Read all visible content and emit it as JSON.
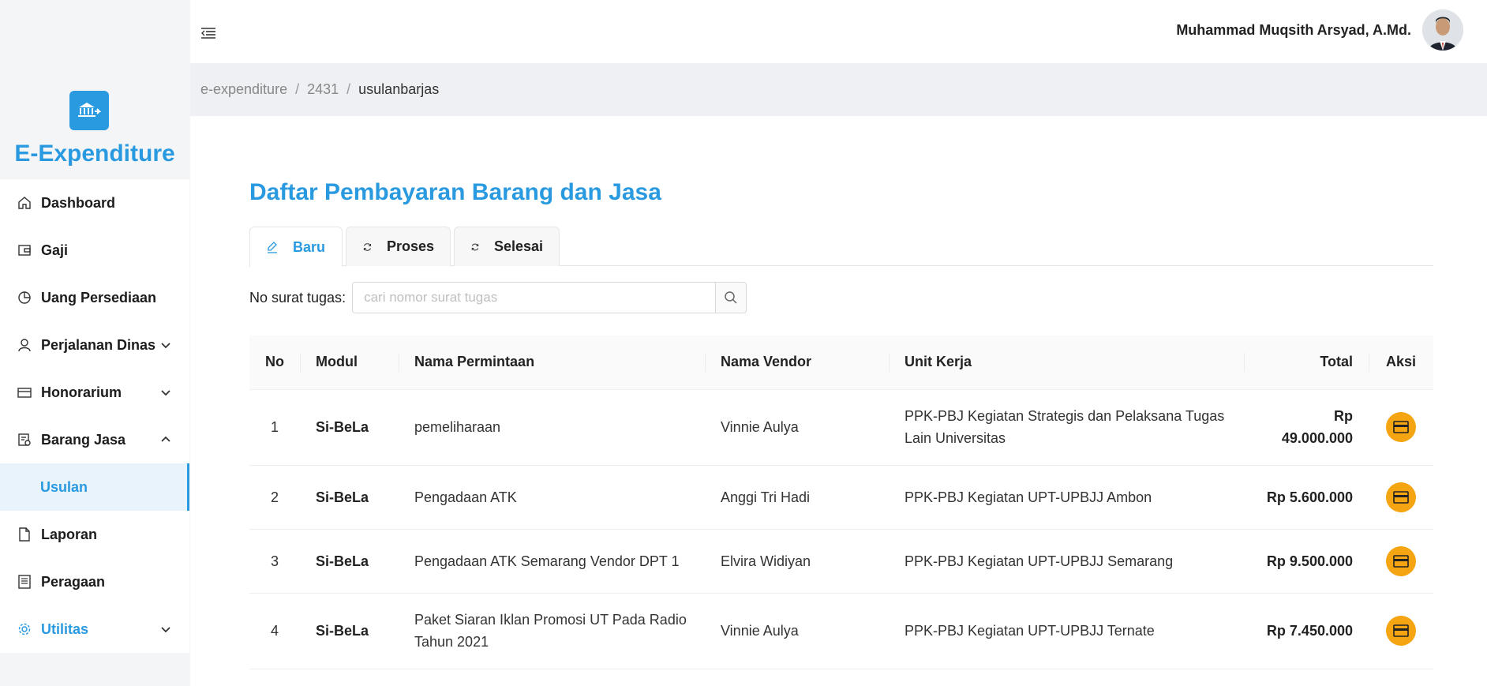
{
  "brand": {
    "name": "E-Expenditure"
  },
  "sidebar": {
    "items": [
      {
        "label": "Dashboard"
      },
      {
        "label": "Gaji"
      },
      {
        "label": "Uang Persediaan"
      },
      {
        "label": "Perjalanan Dinas"
      },
      {
        "label": "Honorarium"
      },
      {
        "label": "Barang Jasa"
      },
      {
        "label": "Usulan"
      },
      {
        "label": "Laporan"
      },
      {
        "label": "Peragaan"
      },
      {
        "label": "Utilitas"
      }
    ]
  },
  "header": {
    "username": "Muhammad Muqsith Arsyad, A.Md."
  },
  "breadcrumb": {
    "items": [
      "e-expenditure",
      "2431",
      "usulanbarjas"
    ]
  },
  "page": {
    "title": "Daftar Pembayaran Barang dan Jasa"
  },
  "tabs": [
    {
      "label": "Baru",
      "icon": "edit-icon"
    },
    {
      "label": "Proses",
      "icon": "sync-icon"
    },
    {
      "label": "Selesai",
      "icon": "sync-icon"
    }
  ],
  "search": {
    "label": "No surat tugas",
    "placeholder": "cari nomor surat tugas",
    "value": ""
  },
  "table": {
    "headers": {
      "no": "No",
      "modul": "Modul",
      "nama_permintaan": "Nama Permintaan",
      "nama_vendor": "Nama Vendor",
      "unit_kerja": "Unit Kerja",
      "total": "Total",
      "aksi": "Aksi"
    },
    "rows": [
      {
        "no": "1",
        "modul": "Si-BeLa",
        "nama_permintaan": "pemeliharaan",
        "nama_vendor": "Vinnie Aulya",
        "unit_kerja": "PPK-PBJ Kegiatan Strategis dan Pelaksana Tugas Lain Universitas",
        "total": "Rp 49.000.000"
      },
      {
        "no": "2",
        "modul": "Si-BeLa",
        "nama_permintaan": "Pengadaan ATK",
        "nama_vendor": "Anggi Tri Hadi",
        "unit_kerja": "PPK-PBJ Kegiatan UPT-UPBJJ Ambon",
        "total": "Rp 5.600.000"
      },
      {
        "no": "3",
        "modul": "Si-BeLa",
        "nama_permintaan": "Pengadaan ATK Semarang Vendor DPT 1",
        "nama_vendor": "Elvira Widiyan",
        "unit_kerja": "PPK-PBJ Kegiatan UPT-UPBJJ Semarang",
        "total": "Rp 9.500.000"
      },
      {
        "no": "4",
        "modul": "Si-BeLa",
        "nama_permintaan": "Paket Siaran Iklan Promosi UT Pada Radio Tahun 2021",
        "nama_vendor": "Vinnie Aulya",
        "unit_kerja": "PPK-PBJ Kegiatan UPT-UPBJJ Ternate",
        "total": "Rp 7.450.000"
      }
    ]
  },
  "colors": {
    "accent": "#2a9ae0",
    "action": "#f5a412"
  }
}
